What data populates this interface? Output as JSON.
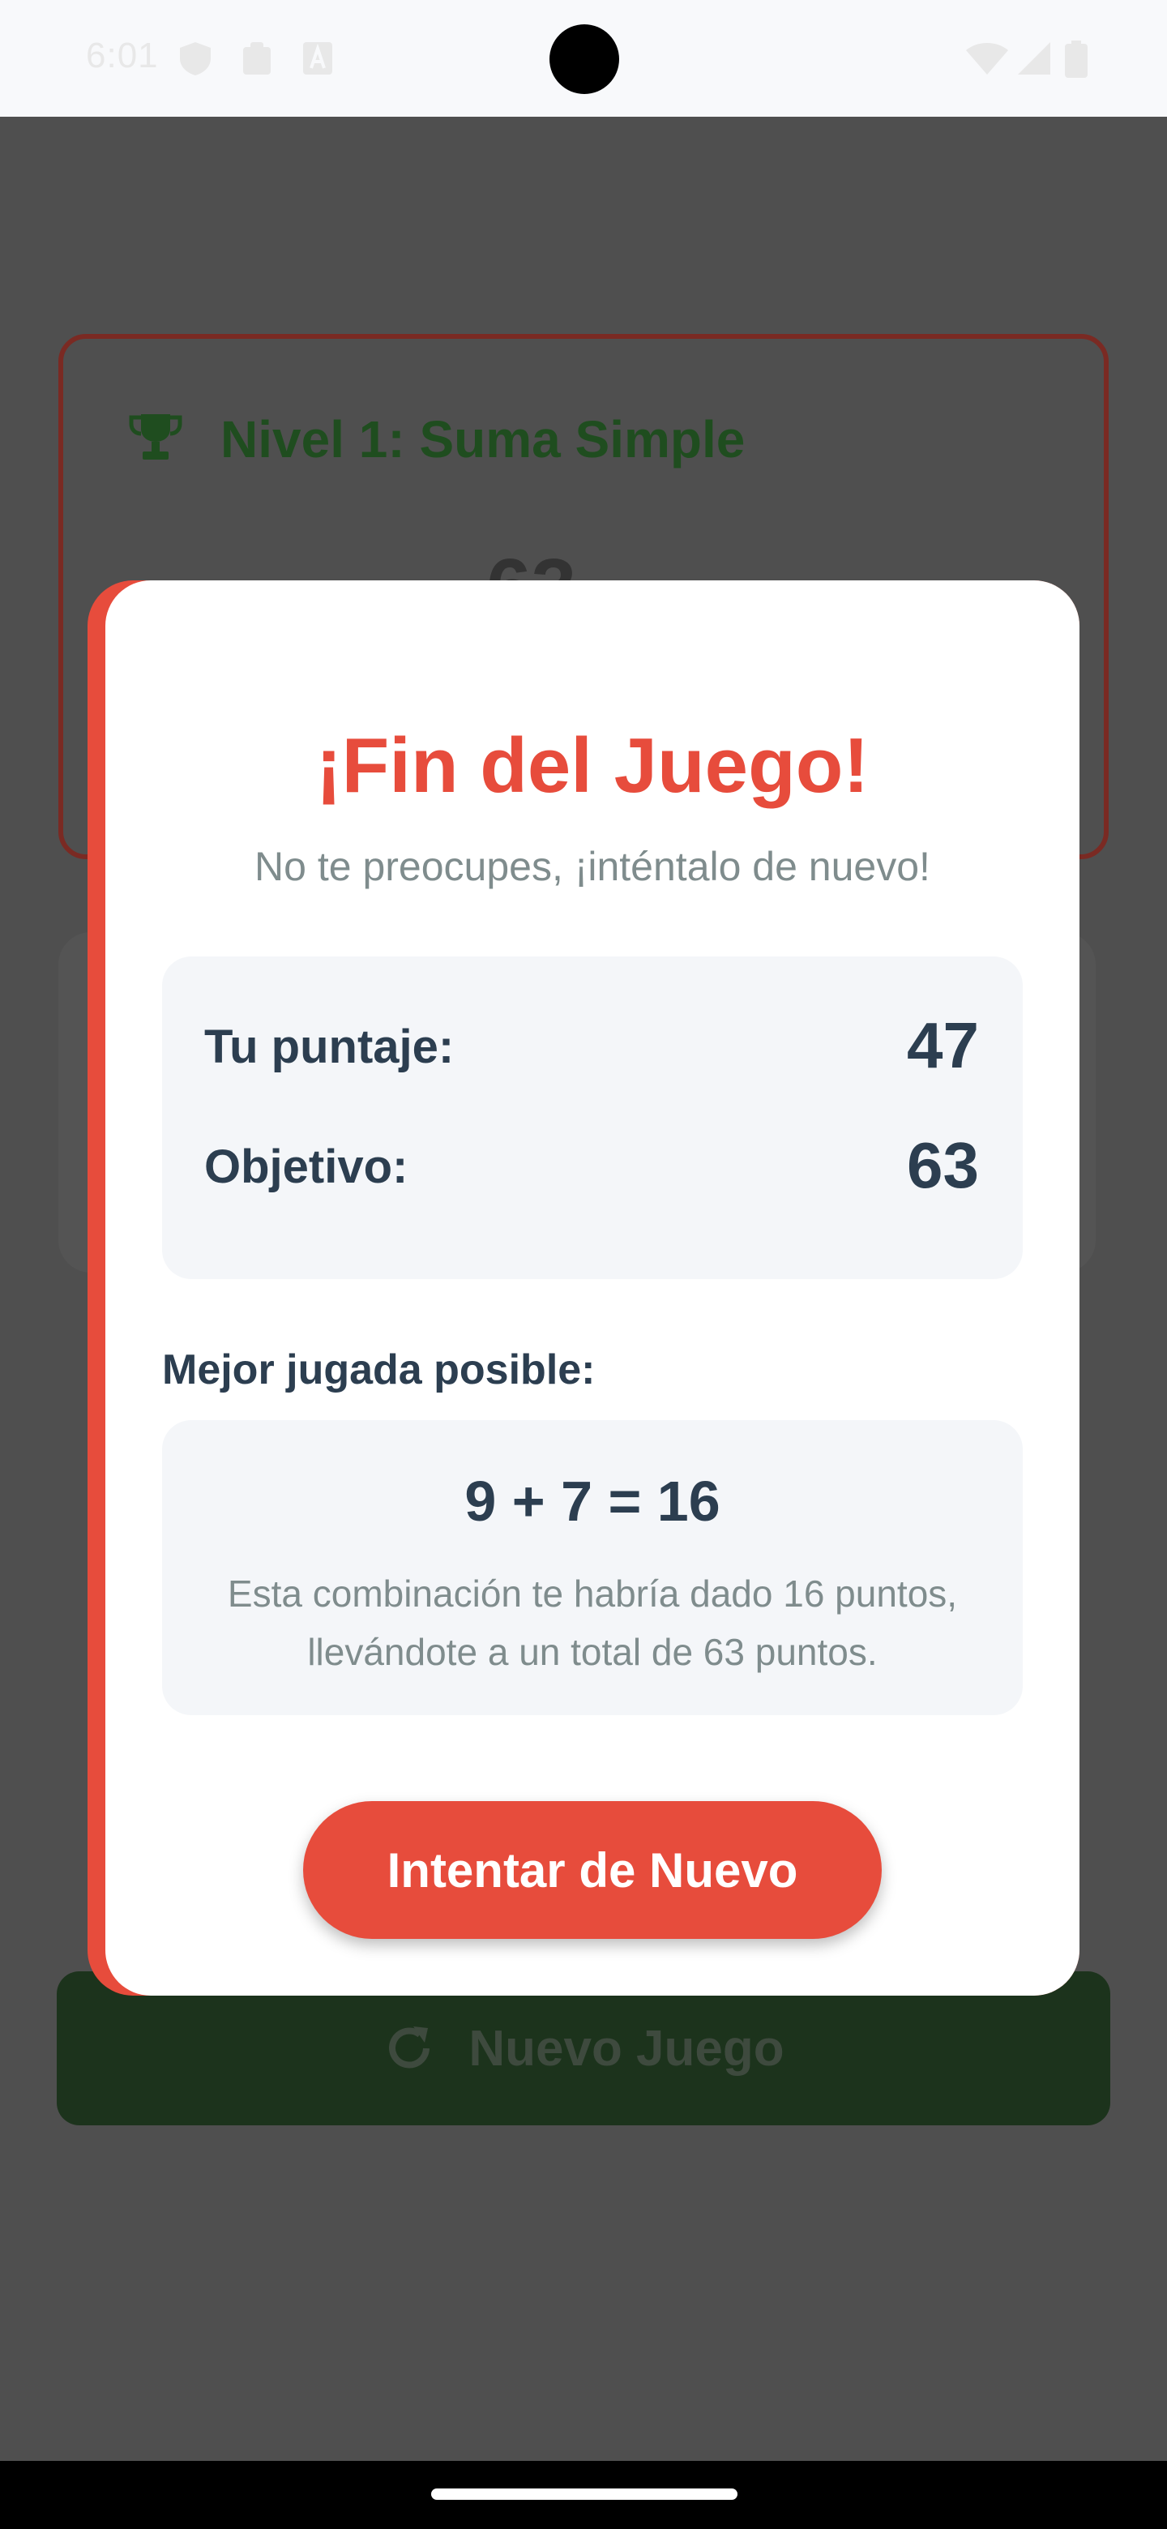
{
  "status_bar": {
    "time": "6:01"
  },
  "game": {
    "level_title": "Nivel 1: Suma Simple",
    "target_partial": "63",
    "new_game_label": "Nuevo Juego"
  },
  "modal": {
    "title": "¡Fin del Juego!",
    "subtitle": "No te preocupes, ¡inténtalo de nuevo!",
    "score_label": "Tu puntaje:",
    "score_value": "47",
    "target_label": "Objetivo:",
    "target_value": "63",
    "best_heading": "Mejor jugada posible:",
    "best_equation": "9 + 7 = 16",
    "best_explanation": "Esta combinación te habría dado 16 puntos, llevándote a un total de 63 puntos.",
    "retry_label": "Intentar de Nuevo"
  },
  "colors": {
    "accent": "#e74c3c",
    "text_dark": "#2c3e50",
    "text_muted": "#7f8c8d",
    "level_green": "#1f4d1f"
  },
  "icons": [
    "shield-icon",
    "clipboard-icon",
    "a-icon",
    "wifi-icon",
    "signal-icon",
    "battery-icon",
    "trophy-icon",
    "refresh-icon"
  ]
}
